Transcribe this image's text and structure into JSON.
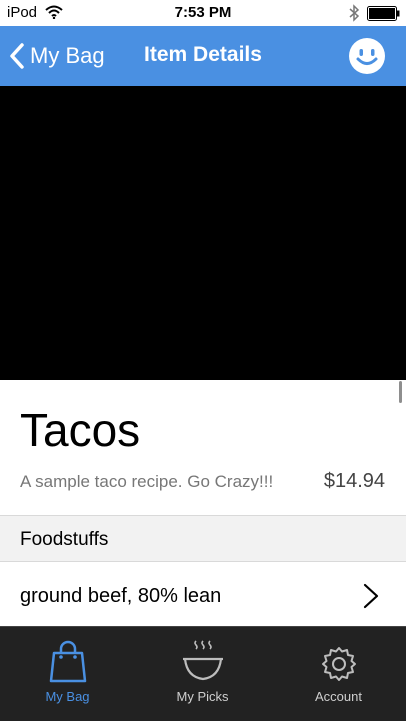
{
  "status": {
    "carrier": "iPod",
    "time": "7:53 PM"
  },
  "nav": {
    "back_label": "My Bag",
    "title": "Item Details",
    "right_icon": "smiley-icon"
  },
  "item": {
    "title": "Tacos",
    "description": "A sample taco recipe. Go Crazy!!!",
    "price": "$14.94"
  },
  "section": {
    "header": "Foodstuffs",
    "rows": [
      {
        "label": "ground beef, 80% lean"
      }
    ]
  },
  "tabs": [
    {
      "label": "My Bag",
      "icon": "shopping-bag-icon",
      "active": true
    },
    {
      "label": "My Picks",
      "icon": "steaming-bowl-icon",
      "active": false
    },
    {
      "label": "Account",
      "icon": "gear-icon",
      "active": false
    }
  ],
  "colors": {
    "accent": "#4a90e2",
    "tab_bar_bg": "#222222",
    "hero_bg": "#000000"
  }
}
